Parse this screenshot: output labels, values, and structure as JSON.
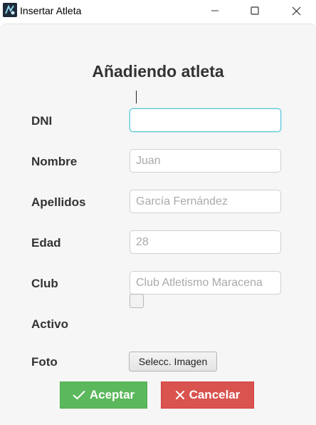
{
  "window": {
    "title": "Insertar Atleta",
    "icon": "app-logo-icon",
    "controls": [
      "minimize-icon",
      "maximize-icon",
      "close-icon"
    ]
  },
  "form": {
    "heading": "Añadiendo atleta",
    "fields": {
      "dni": {
        "label": "DNI",
        "value": "",
        "placeholder": ""
      },
      "nombre": {
        "label": "Nombre",
        "value": "",
        "placeholder": "Juan"
      },
      "apellidos": {
        "label": "Apellidos",
        "value": "",
        "placeholder": "García Fernández"
      },
      "edad": {
        "label": "Edad",
        "value": "",
        "placeholder": "28"
      },
      "club": {
        "label": "Club",
        "value": "",
        "placeholder": "Club Atletismo Maracena"
      },
      "activo": {
        "label": "Activo",
        "checked": false
      },
      "foto": {
        "label": "Foto",
        "button_label": "Selecc. Imagen"
      }
    },
    "actions": {
      "accept": {
        "label": "Aceptar",
        "icon": "check-icon",
        "color": "#5cb85c"
      },
      "cancel": {
        "label": "Cancelar",
        "icon": "x-icon",
        "color": "#d9534f"
      }
    }
  },
  "colors": {
    "focus_border": "#5ec6d6",
    "background": "#f6f6f6",
    "label_text": "#333333"
  }
}
